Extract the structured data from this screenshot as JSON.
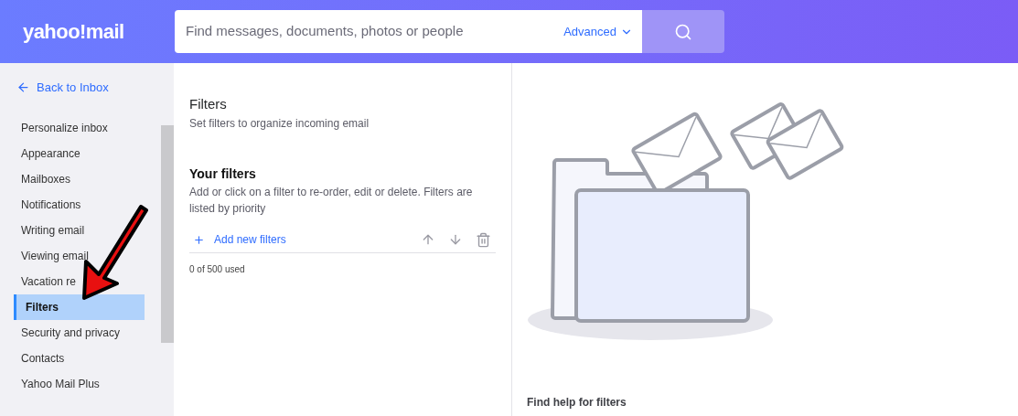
{
  "header": {
    "logo": "yahoo!mail",
    "search": {
      "placeholder": "Find messages, documents, photos or people"
    },
    "advanced": "Advanced"
  },
  "sidebar": {
    "back": "Back to Inbox",
    "items": [
      {
        "label": "Personalize inbox",
        "selected": false
      },
      {
        "label": "Appearance",
        "selected": false
      },
      {
        "label": "Mailboxes",
        "selected": false
      },
      {
        "label": "Notifications",
        "selected": false
      },
      {
        "label": "Writing email",
        "selected": false
      },
      {
        "label": "Viewing email",
        "selected": false
      },
      {
        "label": "Vacation re",
        "selected": false
      },
      {
        "label": "Filters",
        "selected": true
      },
      {
        "label": "Security and privacy",
        "selected": false
      },
      {
        "label": "Contacts",
        "selected": false
      },
      {
        "label": "Yahoo Mail Plus",
        "selected": false
      }
    ]
  },
  "filters": {
    "title": "Filters",
    "subtitle": "Set filters to organize incoming email",
    "section_title": "Your filters",
    "section_text": "Add or click on a filter to re-order, edit or delete. Filters are listed by priority",
    "add": "Add new filters",
    "usage": "0 of 500 used"
  },
  "help": {
    "title": "Find help for filters"
  }
}
